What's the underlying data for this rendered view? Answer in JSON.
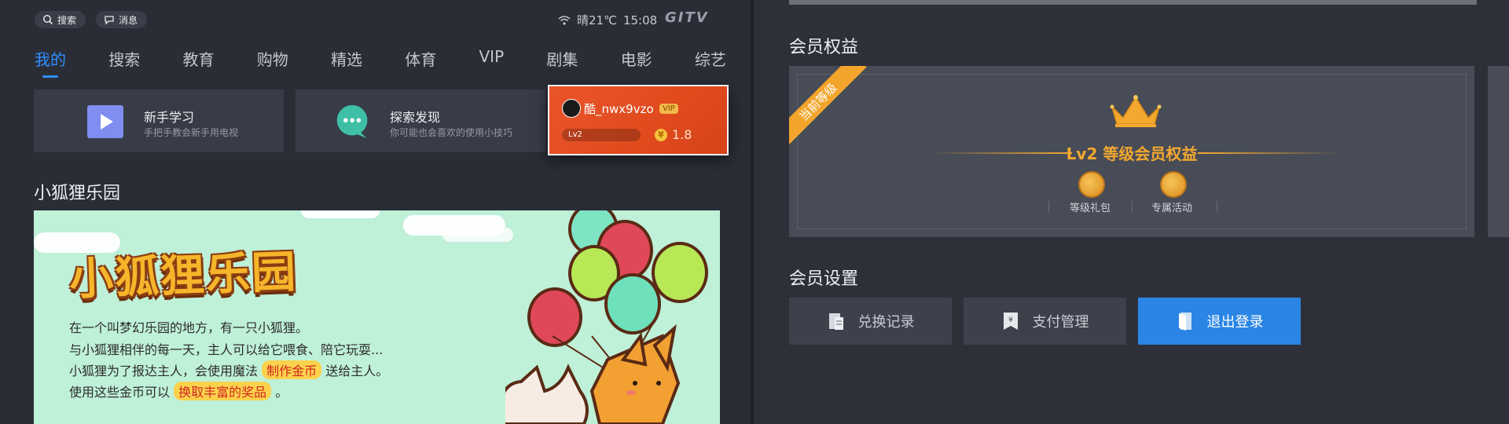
{
  "topbar": {
    "search_label": "搜索",
    "message_label": "消息",
    "weather": "晴21℃",
    "time": "15:08",
    "logo": "GITV"
  },
  "tabs": [
    {
      "label": "我的",
      "active": true
    },
    {
      "label": "搜索"
    },
    {
      "label": "教育"
    },
    {
      "label": "购物"
    },
    {
      "label": "精选"
    },
    {
      "label": "体育"
    },
    {
      "label": "VIP"
    },
    {
      "label": "剧集"
    },
    {
      "label": "电影"
    },
    {
      "label": "综艺"
    }
  ],
  "cards": {
    "newbie": {
      "title": "新手学习",
      "subtitle": "手把手教会新手用电视"
    },
    "explore": {
      "title": "探索发现",
      "subtitle": "你可能也会喜欢的使用小技巧"
    }
  },
  "profile": {
    "username": "酷_nwx9vzo",
    "vip_badge": "VIP",
    "level": "Lv2",
    "coin_symbol": "¥",
    "coins": "1.8"
  },
  "fox_section": {
    "title": "小狐狸乐园",
    "banner_title": "小狐狸乐园",
    "line1": "在一个叫梦幻乐园的地方，有一只小狐狸。",
    "line2": "与小狐狸相伴的每一天，主人可以给它喂食、陪它玩耍...",
    "line3_pre": "小狐狸为了报达主人，会使用魔法",
    "line3_hl": "制作金币",
    "line3_post": "送给主人。",
    "line4_pre": "使用这些金币可以",
    "line4_hl": "换取丰富的奖品",
    "line4_post": "。"
  },
  "member_rights": {
    "title": "会员权益",
    "ribbon": "当前等级",
    "level_title": "Lv2 等级会员权益",
    "benefits": [
      {
        "label": "等级礼包"
      },
      {
        "label": "专属活动"
      }
    ]
  },
  "member_settings": {
    "title": "会员设置",
    "redeem_label": "兑换记录",
    "payment_label": "支付管理",
    "logout_label": "退出登录"
  },
  "colors": {
    "accent": "#2f8fff",
    "gold": "#f3a830",
    "profile_orange": "#e04a1d",
    "logout_blue": "#2a85e4"
  }
}
